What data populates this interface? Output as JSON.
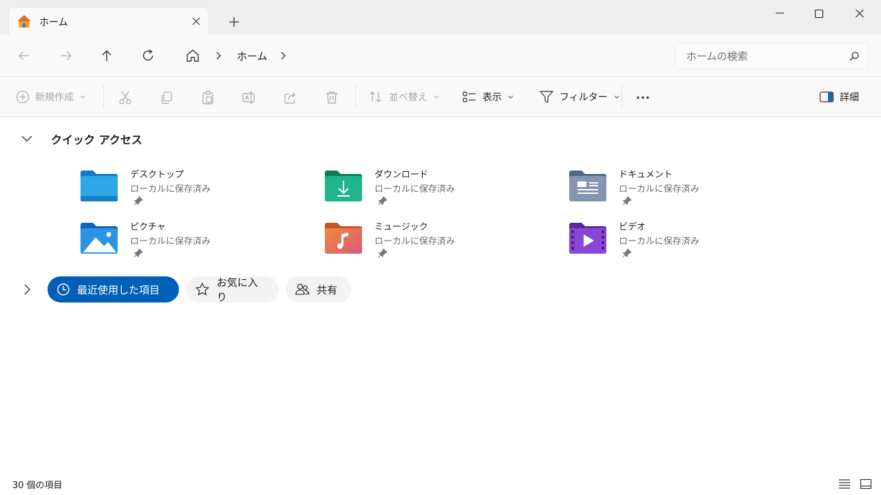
{
  "tab": {
    "title": "ホーム",
    "home_icon": "home-icon",
    "close_icon": "close-icon"
  },
  "new_tab_icon": "plus-icon",
  "window_controls": {
    "minimize": "minimize-icon",
    "maximize": "maximize-icon",
    "close": "close-icon"
  },
  "address": {
    "nav": [
      "back-arrow-icon",
      "forward-arrow-icon",
      "up-arrow-icon",
      "refresh-icon"
    ],
    "breadcrumb": {
      "home_icon": "home-icon",
      "location": "ホーム"
    },
    "search_placeholder": "ホームの検索"
  },
  "toolbar": {
    "new_label": "新規作成",
    "sort_label": "並べ替え",
    "view_label": "表示",
    "filter_label": "フィルター",
    "details_label": "詳細",
    "icons": [
      "cut-icon",
      "copy-icon",
      "paste-icon",
      "rename-icon",
      "share-icon",
      "delete-icon",
      "more-icon"
    ]
  },
  "quick_access": {
    "title": "クイック アクセス",
    "items": [
      {
        "name": "デスクトップ",
        "status": "ローカルに保存済み",
        "icon": "desktop-folder-icon",
        "color": "#1e90d6"
      },
      {
        "name": "ダウンロード",
        "status": "ローカルに保存済み",
        "icon": "download-folder-icon",
        "color": "#1aa37a"
      },
      {
        "name": "ドキュメント",
        "status": "ローカルに保存済み",
        "icon": "documents-folder-icon",
        "color": "#6e7f99"
      },
      {
        "name": "ピクチャ",
        "status": "ローカルに保存済み",
        "icon": "pictures-folder-icon",
        "color": "#1f8ee0"
      },
      {
        "name": "ミュージック",
        "status": "ローカルに保存済み",
        "icon": "music-folder-icon",
        "color": "#e2724c"
      },
      {
        "name": "ビデオ",
        "status": "ローカルに保存済み",
        "icon": "videos-folder-icon",
        "color": "#7b3fc4"
      }
    ]
  },
  "sections": {
    "recent": "最近使用した項目",
    "favorites": "お気に入り",
    "shared": "共有"
  },
  "status": {
    "count": "30 個の項目"
  },
  "colors": {
    "accent": "#005fb8",
    "titlebar": "#eeeeee"
  }
}
